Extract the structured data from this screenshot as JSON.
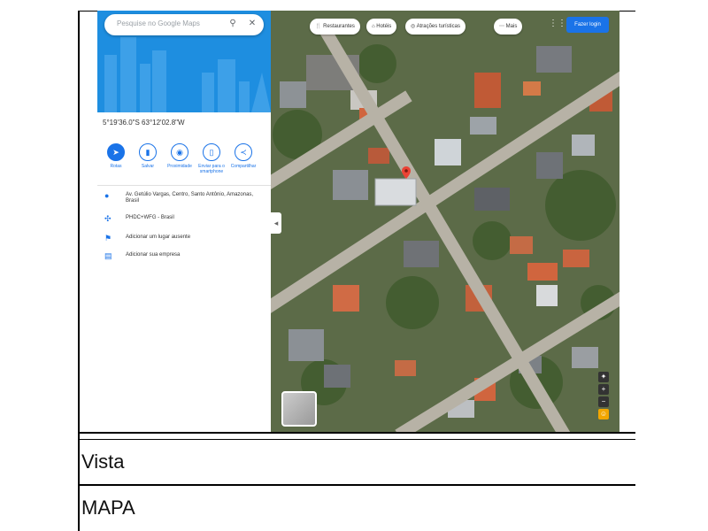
{
  "search": {
    "placeholder": "Pesquise no Google Maps"
  },
  "place": {
    "coordinates": "5°19'36.0\"S 63°12'02.8\"W"
  },
  "actions": [
    {
      "label": "Rotas",
      "icon": "directions-icon"
    },
    {
      "label": "Salvar",
      "icon": "bookmark-icon"
    },
    {
      "label": "Proximidade",
      "icon": "nearby-icon"
    },
    {
      "label": "Enviar para o smartphone",
      "icon": "phone-icon"
    },
    {
      "label": "Compartilhar",
      "icon": "share-icon"
    }
  ],
  "info": [
    {
      "icon": "pin-icon",
      "text": "Av. Getúlio Vargas, Centro, Santo Antônio, Amazonas, Brasil"
    },
    {
      "icon": "plus-code-icon",
      "text": "PHDC+WFG - Brasil"
    },
    {
      "icon": "flag-icon",
      "text": "Adicionar um lugar ausente"
    },
    {
      "icon": "business-icon",
      "text": "Adicionar sua empresa"
    }
  ],
  "chips": [
    {
      "label": "Restaurantes",
      "icon": "fork-knife-icon"
    },
    {
      "label": "Hotéis",
      "icon": "bed-icon"
    },
    {
      "label": "Atrações turísticas",
      "icon": "camera-icon"
    },
    {
      "label": "Mais",
      "icon": "more-icon"
    }
  ],
  "header": {
    "signin": "Fazer login"
  },
  "table": {
    "row1": "Vista",
    "row2": "MAPA"
  },
  "colors": {
    "accent": "#1a73e8",
    "pin": "#ea4335"
  }
}
